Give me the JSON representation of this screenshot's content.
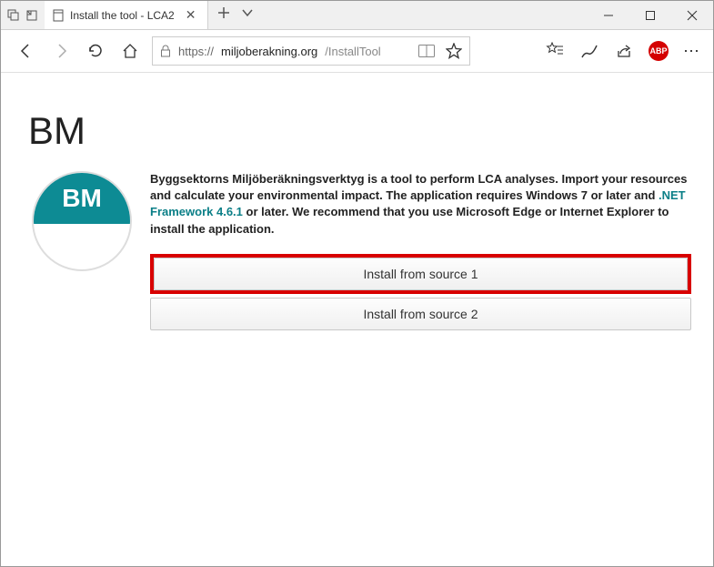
{
  "window": {
    "tab_title": "Install the tool - LCA2"
  },
  "url": {
    "scheme": "https://",
    "domain": "miljoberakning.org",
    "path": "/InstallTool"
  },
  "page": {
    "heading": "BM",
    "logo_text": "BM",
    "desc_part1": "Byggsektorns Miljöberäkningsverktyg is a tool to perform LCA analyses. Import your resources and calculate your environmental impact. The application requires Windows 7 or later and ",
    "link_text": ".NET Framework 4.6.1",
    "desc_part2": " or later. We recommend that you use Microsoft Edge or Internet Explorer to install the application.",
    "install1_label": "Install from source 1",
    "install2_label": "Install from source 2"
  },
  "abp_label": "ABP"
}
